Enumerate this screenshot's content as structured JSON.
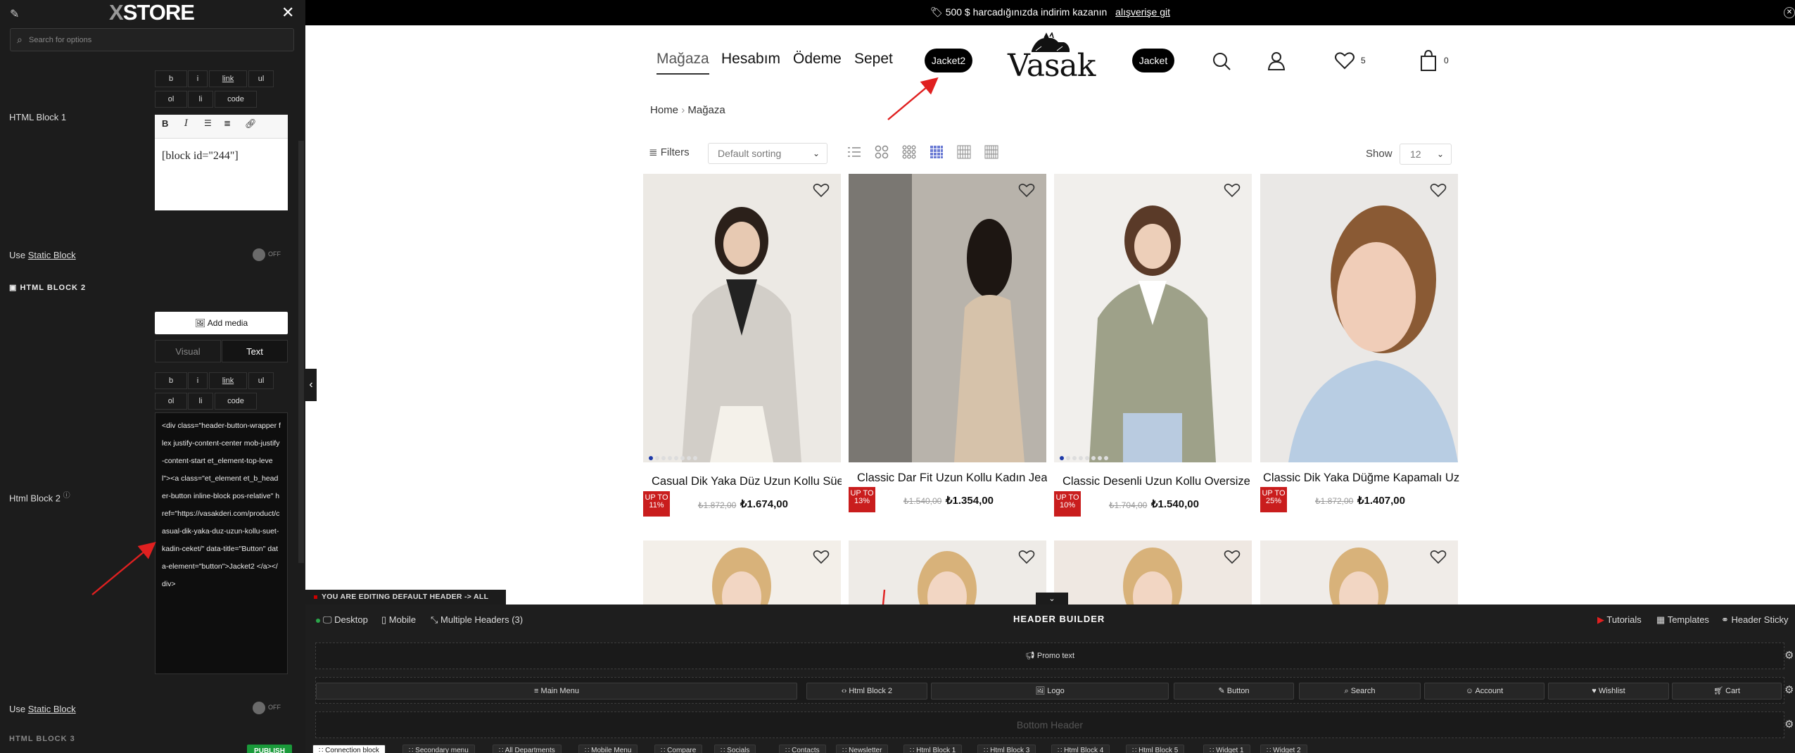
{
  "left_panel": {
    "logo_x": "X",
    "logo_text": "STORE",
    "search_placeholder": "Search for options",
    "tags": [
      "b",
      "i",
      "link",
      "ul",
      "ol",
      "li",
      "code"
    ],
    "html_block_1_label": "HTML Block 1",
    "html_block_1_content": "[block id=\"244\"]",
    "use_label": "Use",
    "static_block_label": "Static Block",
    "toggle_off": "OFF",
    "section_html_block_2": "HTML BLOCK 2",
    "add_media": "Add media",
    "tab_visual": "Visual",
    "tab_text": "Text",
    "html_block_2_label": "Html Block 2",
    "html_block_2_code": "<div class=\"header-button-wrapper flex justify-content-center mob-justify-content-start et_element-top-level\"><a class=\"et_element et_b_header-button inline-block pos-relative\" href=\"https://vasakderi.com/product/casual-dik-yaka-duz-uzun-kollu-suet-kadin-ceket/\" data-title=\"Button\" data-element=\"button\">Jacket2 </a></div>",
    "next_section": "HTML BLOCK 3",
    "publish": "PUBLISH"
  },
  "promo": {
    "text": "500 $ harcadığınızda indirim kazanın",
    "link": "alışverişe git"
  },
  "nav": {
    "items": [
      "Mağaza",
      "Hesabım",
      "Ödeme",
      "Sepet"
    ],
    "pill_left": "Jacket2",
    "pill_right": "Jacket",
    "brand": "Vasak",
    "wishlist_count": "5",
    "cart_count": "0"
  },
  "breadcrumb": {
    "home": "Home",
    "sep": "›",
    "current": "Mağaza"
  },
  "toolbar": {
    "filters": "Filters",
    "sorting": "Default sorting",
    "show_label": "Show",
    "show_value": "12"
  },
  "products": [
    {
      "title": "Casual Dik Yaka Düz Uzun Kollu Süet",
      "badge": "UP TO 11%",
      "old_price": "₺1.872,00",
      "new_price": "₺1.674,00",
      "bg": "#ece9e4"
    },
    {
      "title": "Classic Dar Fit Uzun Kollu Kadın Jean",
      "badge": "UP TO 13%",
      "old_price": "₺1.540,00",
      "new_price": "₺1.354,00",
      "bg": "#b8b3ab"
    },
    {
      "title": "Classic Desenli Uzun Kollu Oversize",
      "badge": "UP TO 10%",
      "old_price": "₺1.704,00",
      "new_price": "₺1.540,00",
      "bg": "#f1efec"
    },
    {
      "title": "Classic Dik Yaka Düğme Kapamalı Uzun",
      "badge": "UP TO 25%",
      "old_price": "₺1.872,00",
      "new_price": "₺1.407,00",
      "bg": "#eae8e6"
    }
  ],
  "row2_bg": [
    "#f3efe9",
    "#eeebe7",
    "#efe8e2",
    "#f0ece8"
  ],
  "builder": {
    "editing_notice": "YOU ARE EDITING DEFAULT HEADER -> ALL SITE",
    "desktop": "Desktop",
    "mobile": "Mobile",
    "multiple_headers": "Multiple Headers (3)",
    "title": "HEADER BUILDER",
    "tutorials": "Tutorials",
    "templates": "Templates",
    "header_sticky": "Header Sticky",
    "promo_item": "Promo text",
    "main_row": [
      "Main Menu",
      "Html Block 2",
      "Logo",
      "Button",
      "Search",
      "Account",
      "Wishlist",
      "Cart"
    ],
    "bottom_header": "Bottom Header",
    "dock_tabs": [
      "Connection block",
      "Secondary menu",
      "All Departments",
      "Mobile Menu",
      "Compare",
      "Socials",
      "Contacts",
      "Newsletter",
      "Html Block 1",
      "Html Block 3",
      "Html Block 4",
      "Html Block 5",
      "Widget 1",
      "Widget 2"
    ]
  },
  "colors": {
    "accent_red": "#e02020",
    "badge_red": "#c91d1d",
    "publish_green": "#1a9a3a",
    "dot_blue": "#1e3aa8",
    "active_grid": "#6b7bd4"
  }
}
